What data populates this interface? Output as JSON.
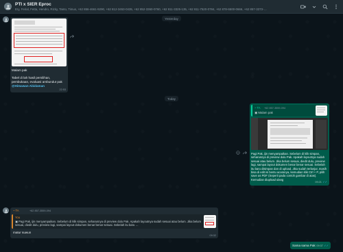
{
  "header": {
    "title": "PTI x SIER Eproc",
    "members": "Ery, Ferial, Fetta, Hendro, Rizky, Tanto, Timus, +62 856-4661-9290, +62 812-3453-0435, +62 852-3360-0760, +62 811-3325-135, +62 811-7520-0784, +62 878-6500-0666, +62 857-3373-…",
    "icons": [
      "video-icon",
      "chevron-down-icon",
      "search-icon",
      "menu-icon"
    ]
  },
  "dates": {
    "yesterday": "Yesterday",
    "today": "Today"
  },
  "msg1": {
    "text1": "Malam pak",
    "text2": "Tabel di lah hasil pemilihan, pembukaan, evaluasi ambunduI pak",
    "mention": "@Himawan Abidaman",
    "time": "22:53"
  },
  "msg2": {
    "quote_name": "~ TA",
    "quote_phone": "+62 857-3559-094",
    "quote_text": "Malam pak",
    "text": "Pagi Pak, ijin menyampaikan. Sebelum di klik simpan, seharusnya di preview dulu Pak. Apakah layoutnya sudah sesuai atau belum. Jika belum sesuai, diedit dulu, preview lagi, sampai layout dokumen benar benar sesuai. Sebelah itu baru disimpan dan di upload. Jika sudah terlanjur, masih bisa di edit isi bentu acaranya, kemudian klik Ctrl + P, pilih save as PDF (Seperti pada contoh gambar di atas). Kemudian diupload ulang",
    "time": "09:21"
  },
  "msg3": {
    "sender": "~ TA",
    "sender_phone": "+62 857-3559-094",
    "quote_name": "You",
    "quote_text": "Pagi Pak, ijin menyampaikan. Sebelum di klik simpan, seharusnya di preview dulu Pak. Apakah layoutnya sudah sesuai atau belum. Jika belum sesuai, diedit dulu, preview lagi, sampai layout dokumen benar benar sesuai. Sebelah itu baru …",
    "text": "matur suwun",
    "time": "09:32"
  },
  "msg4": {
    "text": "Sama sama Pak",
    "time": "09:37"
  },
  "colors": {
    "header_bg": "#202c33",
    "chat_bg": "#0b141a",
    "incoming": "#202c33",
    "outgoing": "#005c4b",
    "accent": "#06cf9c",
    "mention": "#53bdeb"
  }
}
